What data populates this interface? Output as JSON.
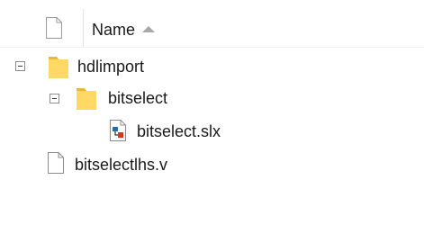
{
  "header": {
    "name_column": "Name",
    "sort_direction": "ascending"
  },
  "tree": [
    {
      "label": "hdlimport",
      "type": "folder",
      "expanded": true,
      "level": 0
    },
    {
      "label": "bitselect",
      "type": "folder",
      "expanded": true,
      "level": 1
    },
    {
      "label": "bitselect.slx",
      "type": "simulink-model",
      "level": 2
    },
    {
      "label": "bitselectlhs.v",
      "type": "file",
      "level": 0
    }
  ],
  "colors": {
    "folder": "#ffd25c",
    "folder_shade": "#e8b83a",
    "file_border": "#8c8c8c"
  },
  "icons": [
    "blank-file-icon",
    "folder-icon",
    "simulink-model-icon",
    "collapse-toggle-icon",
    "sort-ascending-icon"
  ]
}
